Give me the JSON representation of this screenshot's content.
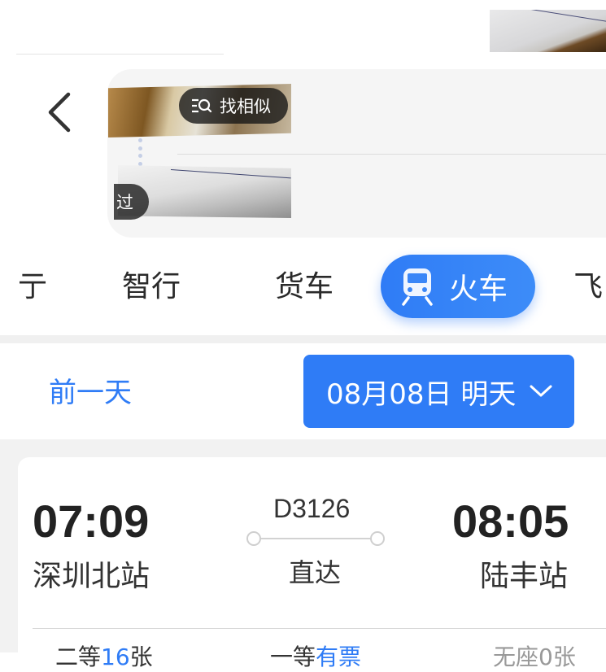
{
  "header": {
    "similar_label": "找相似",
    "pass_label": "过"
  },
  "tabs": [
    {
      "label": "亍"
    },
    {
      "label": "智行"
    },
    {
      "label": "货车"
    },
    {
      "label": "火车",
      "active": true
    },
    {
      "label": "飞"
    }
  ],
  "date_bar": {
    "prev_label": "前一天",
    "selected_date": "08月08日 明天"
  },
  "train": {
    "departure_time": "07:09",
    "departure_station": "深圳北站",
    "train_number": "D3126",
    "route_type": "直达",
    "arrival_time": "08:05",
    "arrival_station": "陆丰站"
  },
  "seats": [
    {
      "prefix": "二等",
      "count": "16",
      "suffix": "张"
    },
    {
      "prefix": "一等",
      "status": "有票"
    },
    {
      "text": "无座0张"
    }
  ],
  "colors": {
    "accent": "#2f7cf6",
    "text": "#333333",
    "muted": "#999999",
    "background": "#f2f2f2"
  }
}
